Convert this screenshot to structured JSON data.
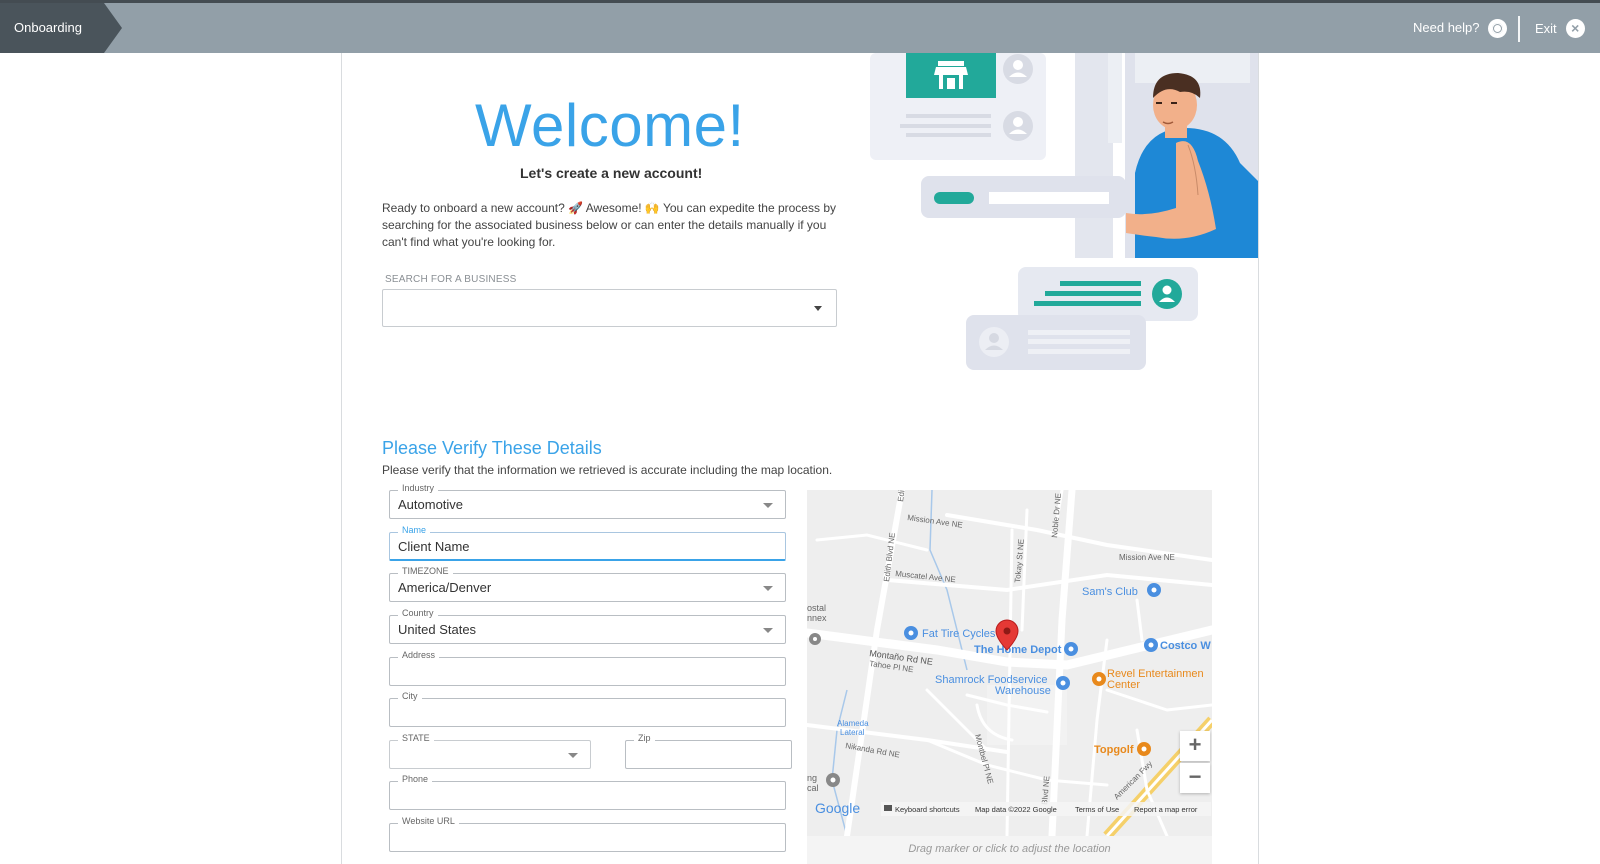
{
  "topbar": {
    "breadcrumb": "Onboarding",
    "help_label": "Need help?",
    "exit_label": "Exit"
  },
  "hero": {
    "title": "Welcome!",
    "subtitle": "Let's create a new account!",
    "intro_before": "Ready to onboard a new account? ",
    "emoji_rocket": "🚀",
    "intro_mid": " Awesome! ",
    "emoji_hands": "🙌",
    "intro_after": " You can expedite the process by searching for the associated business below or can enter the details manually if you can't find what you're looking for.",
    "search_label": "SEARCH FOR A BUSINESS",
    "search_value": ""
  },
  "verify": {
    "title": "Please Verify These Details",
    "description": "Please verify that the information we retrieved is accurate including the map location."
  },
  "form": {
    "industry": {
      "label": "Industry",
      "value": "Automotive"
    },
    "name": {
      "label": "Name",
      "value": "Client Name"
    },
    "timezone": {
      "label": "TIMEZONE",
      "value": "America/Denver"
    },
    "country": {
      "label": "Country",
      "value": "United States"
    },
    "address": {
      "label": "Address",
      "value": ""
    },
    "city": {
      "label": "City",
      "value": ""
    },
    "state": {
      "label": "STATE",
      "value": ""
    },
    "zip": {
      "label": "Zip",
      "value": ""
    },
    "phone": {
      "label": "Phone",
      "value": ""
    },
    "website": {
      "label": "Website URL",
      "value": ""
    }
  },
  "map": {
    "caption": "Drag marker or click to adjust the location",
    "zoom_in": "+",
    "zoom_out": "−",
    "logo": "Google",
    "footer": {
      "shortcuts": "Keyboard shortcuts",
      "data": "Map data ©2022 Google",
      "terms": "Terms of Use",
      "report": "Report a map error"
    },
    "streets": {
      "mission_ave_1": "Mission Ave NE",
      "mission_ave_2": "Mission Ave NE",
      "muscatel": "Muscatel Ave NE",
      "edith": "Edith Blvd NE",
      "edith_top": "Edi",
      "tokay": "Tokay St NE",
      "noble": "Noble Dr NE",
      "montano": "Montaño Rd NE",
      "tahoe": "Tahoe Pl NE",
      "alameda": "Alameda Lateral",
      "nikanda": "Nikanda Rd NE",
      "monte": "Montbel Pl NE",
      "blvd": "Blvd NE",
      "american": "American Fwy",
      "postal_1": "ostal",
      "postal_2": "nnex",
      "ng_1": "ng",
      "ng_2": "cal"
    },
    "places": {
      "sams": "Sam's Club",
      "fat_tire": "Fat Tire Cycles",
      "home_depot": "The Home Depot",
      "costco": "Costco W",
      "shamrock_1": "Shamrock Foodservice",
      "shamrock_2": "Warehouse",
      "revel_1": "Revel Entertainmen",
      "revel_2": "Center",
      "topgolf": "Topgolf"
    },
    "colors": {
      "blue_place": "#4a8fe0",
      "orange_place": "#e8891c",
      "marker": "#e53935"
    }
  }
}
